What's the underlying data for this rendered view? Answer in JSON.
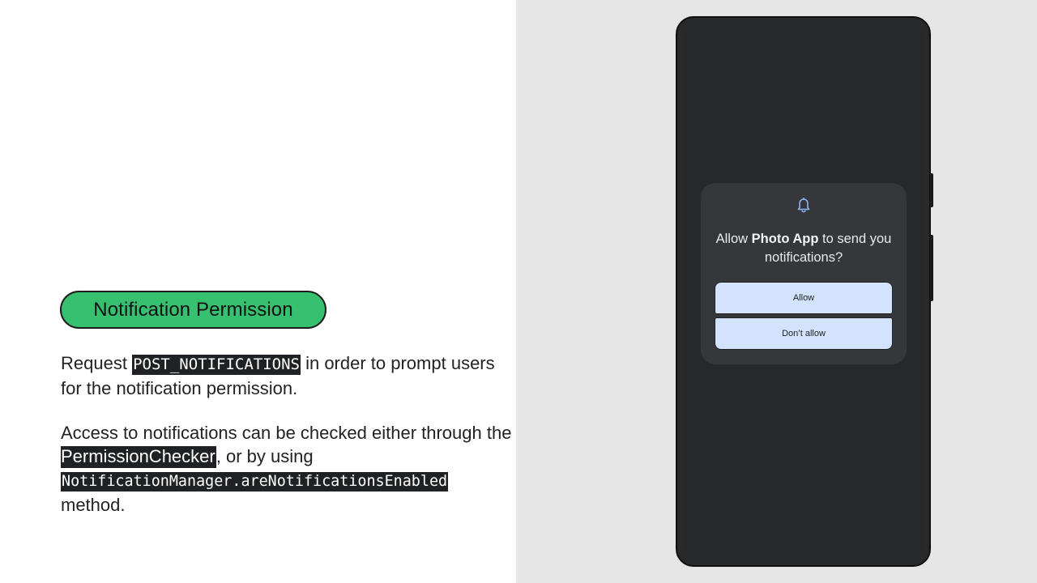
{
  "slide": {
    "pill_title": "Notification Permission",
    "paragraph1": {
      "prefix": "Request ",
      "code": "POST_NOTIFICATIONS",
      "suffix": " in order to prompt users for the notification permission."
    },
    "paragraph2": {
      "prefix": "Access to notifications can be checked either through the ",
      "class_name": "PermissionChecker",
      "middle": ", or by using ",
      "code": "NotificationManager.areNotificationsEnabled",
      "suffix": " method."
    }
  },
  "dialog": {
    "icon": "bell-icon",
    "title_prefix": "Allow ",
    "app_name": "Photo App",
    "title_suffix": " to send you notifications?",
    "allow_label": "Allow",
    "deny_label": "Don’t allow"
  },
  "colors": {
    "pill_green": "#36c06f",
    "code_bg": "#202124",
    "right_panel_bg": "#e6e6e6",
    "phone_body": "#28292b",
    "dialog_bg": "#35373a",
    "button_bg": "#d3e3fd",
    "bell_color": "#8ab4f8"
  }
}
